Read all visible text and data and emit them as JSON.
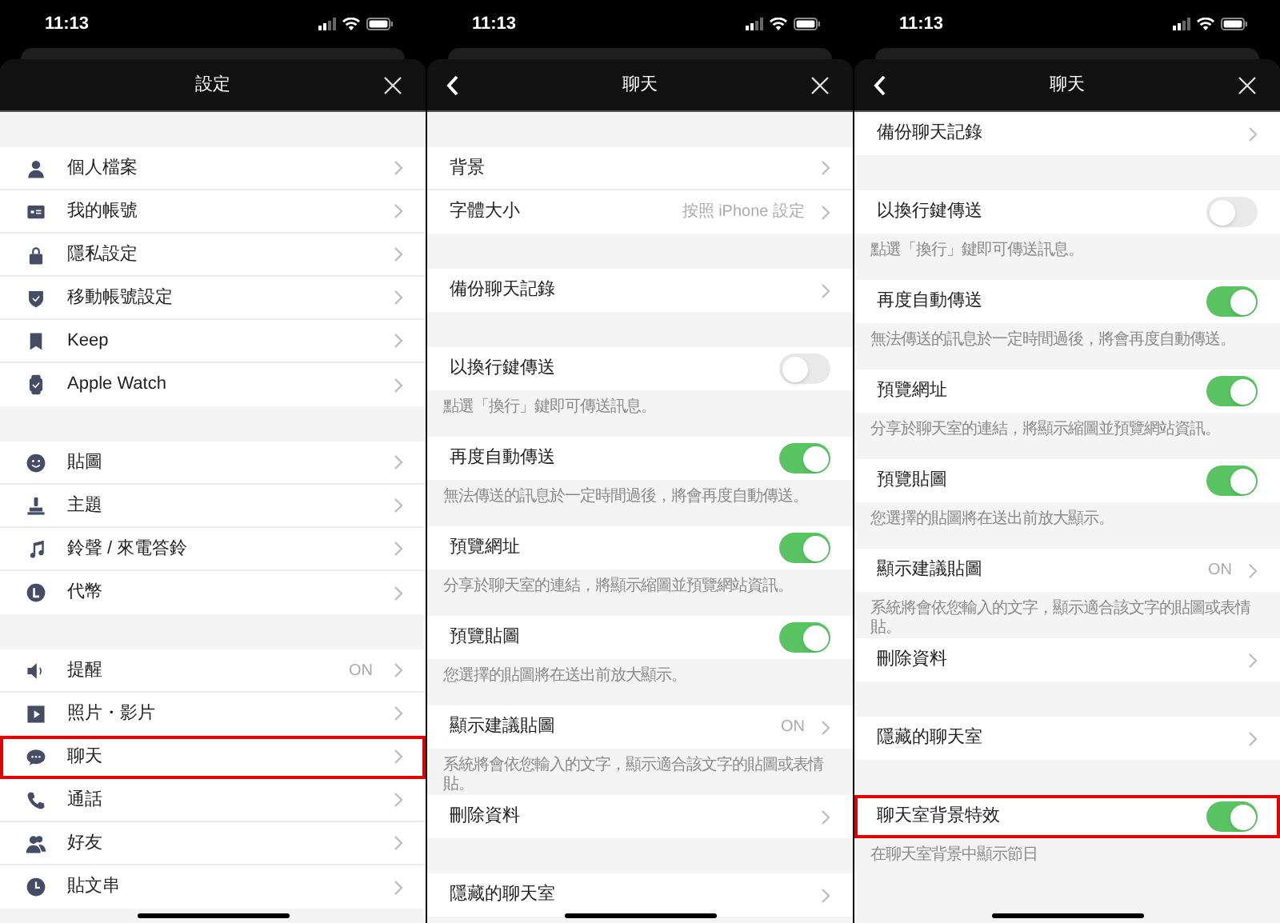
{
  "panels": [
    {
      "status_time": "11:13",
      "title": "設定",
      "has_back": false,
      "items": [
        {
          "kind": "gap"
        },
        {
          "kind": "link",
          "label": "個人檔案",
          "highlighted": false
        },
        {
          "kind": "link",
          "label": "我的帳號",
          "highlighted": false
        },
        {
          "kind": "link",
          "label": "隱私設定",
          "highlighted": false
        },
        {
          "kind": "link",
          "label": "移動帳號設定",
          "highlighted": false
        },
        {
          "kind": "link",
          "label": "Keep",
          "highlighted": false
        },
        {
          "kind": "link",
          "label": "Apple Watch",
          "highlighted": false
        },
        {
          "kind": "gap"
        },
        {
          "kind": "link",
          "label": "貼圖",
          "highlighted": false
        },
        {
          "kind": "link",
          "label": "主題",
          "highlighted": false
        },
        {
          "kind": "link",
          "label": "鈴聲 / 來電答鈴",
          "highlighted": false
        },
        {
          "kind": "link",
          "label": "代幣",
          "highlighted": false
        },
        {
          "kind": "gap"
        },
        {
          "kind": "link",
          "label": "提醒",
          "value": "ON",
          "highlighted": false
        },
        {
          "kind": "link",
          "label": "照片・影片",
          "highlighted": false
        },
        {
          "kind": "link",
          "label": "聊天",
          "highlighted": true
        },
        {
          "kind": "link",
          "label": "通話",
          "highlighted": false
        },
        {
          "kind": "link",
          "label": "好友",
          "highlighted": false
        },
        {
          "kind": "link",
          "label": "貼文串",
          "highlighted": false
        }
      ]
    },
    {
      "status_time": "11:13",
      "title": "聊天",
      "has_back": true,
      "items": [
        {
          "kind": "gap"
        },
        {
          "kind": "link",
          "label": "背景",
          "highlighted": false
        },
        {
          "kind": "link",
          "label": "字體大小",
          "value": "按照 iPhone 設定",
          "highlighted": false
        },
        {
          "kind": "gap"
        },
        {
          "kind": "link",
          "label": "備份聊天記錄",
          "highlighted": false
        },
        {
          "kind": "gap"
        },
        {
          "kind": "toggle",
          "label": "以換行鍵傳送",
          "on": false,
          "highlighted": false
        },
        {
          "kind": "caption",
          "text": "點選「換行」鍵即可傳送訊息。"
        },
        {
          "kind": "toggle",
          "label": "再度自動傳送",
          "on": true,
          "highlighted": false
        },
        {
          "kind": "caption",
          "text": "無法傳送的訊息於一定時間過後，將會再度自動傳送。"
        },
        {
          "kind": "toggle",
          "label": "預覽網址",
          "on": true,
          "highlighted": false
        },
        {
          "kind": "caption",
          "text": "分享於聊天室的連結，將顯示縮圖並預覽網站資訊。"
        },
        {
          "kind": "toggle",
          "label": "預覽貼圖",
          "on": true,
          "highlighted": false
        },
        {
          "kind": "caption",
          "text": "您選擇的貼圖將在送出前放大顯示。"
        },
        {
          "kind": "link",
          "label": "顯示建議貼圖",
          "value": "ON",
          "highlighted": false
        },
        {
          "kind": "caption",
          "text": "系統將會依您輸入的文字，顯示適合該文字的貼圖或表情貼。"
        },
        {
          "kind": "link",
          "label": "刪除資料",
          "highlighted": false
        },
        {
          "kind": "gap"
        },
        {
          "kind": "link",
          "label": "隱藏的聊天室",
          "highlighted": false
        }
      ]
    },
    {
      "status_time": "11:13",
      "title": "聊天",
      "has_back": true,
      "items": [
        {
          "kind": "link",
          "label": "備份聊天記錄",
          "highlighted": false
        },
        {
          "kind": "gap"
        },
        {
          "kind": "toggle",
          "label": "以換行鍵傳送",
          "on": false,
          "highlighted": false
        },
        {
          "kind": "caption",
          "text": "點選「換行」鍵即可傳送訊息。"
        },
        {
          "kind": "toggle",
          "label": "再度自動傳送",
          "on": true,
          "highlighted": false
        },
        {
          "kind": "caption",
          "text": "無法傳送的訊息於一定時間過後，將會再度自動傳送。"
        },
        {
          "kind": "toggle",
          "label": "預覽網址",
          "on": true,
          "highlighted": false
        },
        {
          "kind": "caption",
          "text": "分享於聊天室的連結，將顯示縮圖並預覽網站資訊。"
        },
        {
          "kind": "toggle",
          "label": "預覽貼圖",
          "on": true,
          "highlighted": false
        },
        {
          "kind": "caption",
          "text": "您選擇的貼圖將在送出前放大顯示。"
        },
        {
          "kind": "link",
          "label": "顯示建議貼圖",
          "value": "ON",
          "highlighted": false
        },
        {
          "kind": "caption",
          "text": "系統將會依您輸入的文字，顯示適合該文字的貼圖或表情貼。"
        },
        {
          "kind": "link",
          "label": "刪除資料",
          "highlighted": false
        },
        {
          "kind": "gap"
        },
        {
          "kind": "link",
          "label": "隱藏的聊天室",
          "highlighted": false
        },
        {
          "kind": "gap"
        },
        {
          "kind": "toggle",
          "label": "聊天室背景特效",
          "on": true,
          "highlighted": true
        },
        {
          "kind": "caption",
          "text": "在聊天室背景中顯示節日"
        }
      ]
    }
  ]
}
